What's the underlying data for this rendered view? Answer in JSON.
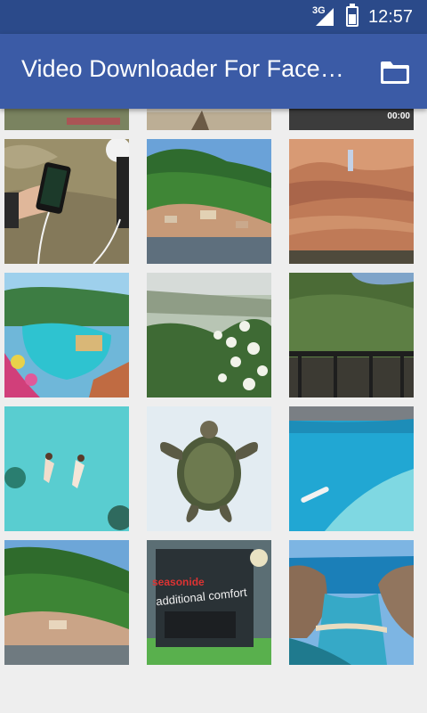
{
  "status_bar": {
    "network": "3G",
    "time": "12:57",
    "battery": 0.5
  },
  "app_bar": {
    "title": "Video Downloader For Facebook",
    "folder_icon": "folder-icon"
  },
  "colors": {
    "status_bar": "#2b4a8a",
    "app_bar": "#3b5ba6",
    "background": "#eeeeee"
  },
  "thumbnails": [
    {
      "name": "video-thumb-partial-1"
    },
    {
      "name": "video-thumb-partial-2"
    },
    {
      "name": "video-thumb-partial-3",
      "duration": "00:00"
    },
    {
      "name": "video-thumb-phone-charging"
    },
    {
      "name": "video-thumb-mountain-village"
    },
    {
      "name": "video-thumb-red-canyon"
    },
    {
      "name": "video-thumb-tropical-resort-pool"
    },
    {
      "name": "video-thumb-misty-flowers"
    },
    {
      "name": "video-thumb-forest-balcony"
    },
    {
      "name": "video-thumb-swimmers-lagoon"
    },
    {
      "name": "video-thumb-sea-turtle"
    },
    {
      "name": "video-thumb-kayak-turquoise"
    },
    {
      "name": "video-thumb-green-hills"
    },
    {
      "name": "video-thumb-seat-cushion",
      "brand": "seasonide",
      "caption": "additional comfort"
    },
    {
      "name": "video-thumb-coastal-bay"
    }
  ]
}
